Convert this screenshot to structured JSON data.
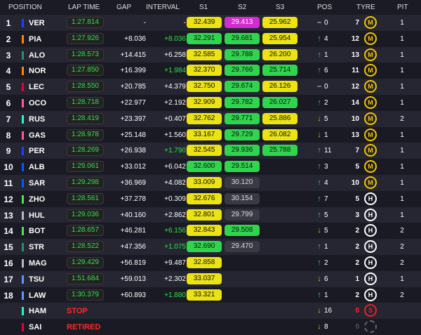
{
  "header": {
    "position": "POSITION",
    "lap_time": "LAP TIME",
    "gap": "GAP",
    "interval": "INTERVAL",
    "s1": "S1",
    "s2": "S2",
    "s3": "S3",
    "pos": "POS",
    "tyre": "TYRE",
    "pit": "PIT"
  },
  "colors": {
    "red_bull": "#1e41ff",
    "mclaren": "#ff8700",
    "aston": "#2a8f6a",
    "ferrari": "#e8002d",
    "alpine": "#ff5aa0",
    "mercedes": "#27f4d2",
    "williams": "#005aff",
    "haas": "#b6babd",
    "kick": "#52e252",
    "rb": "#6692ff"
  },
  "rows": [
    {
      "pos": "1",
      "driver": "VER",
      "team_color": "#1e41ff",
      "lap": "1:27.814",
      "gap": "-",
      "interval": "-",
      "interval_color": "#ffffff",
      "s1": "32.439",
      "s1c": "y",
      "s2": "29.413",
      "s2c": "p",
      "s3": "25.962",
      "s3c": "y",
      "arrow": "–",
      "arrow_dir": "eq",
      "chg": "0",
      "tyre_age": "7",
      "tyre": "M",
      "pit": "1"
    },
    {
      "pos": "2",
      "driver": "PIA",
      "team_color": "#ff8700",
      "lap": "1:27.926",
      "gap": "+8.036",
      "interval": "+8.036",
      "interval_color": "#2fe34a",
      "s1": "32.291",
      "s1c": "g",
      "s2": "29.681",
      "s2c": "g",
      "s3": "25.954",
      "s3c": "y",
      "arrow": "↑",
      "arrow_dir": "up",
      "chg": "4",
      "tyre_age": "12",
      "tyre": "M",
      "pit": "1"
    },
    {
      "pos": "3",
      "driver": "ALO",
      "team_color": "#2a8f6a",
      "lap": "1:28.573",
      "gap": "+14.415",
      "interval": "+6.258",
      "interval_color": "#ffffff",
      "s1": "32.585",
      "s1c": "y",
      "s2": "29.788",
      "s2c": "g",
      "s3": "26.200",
      "s3c": "y",
      "arrow": "↑",
      "arrow_dir": "up",
      "chg": "1",
      "tyre_age": "13",
      "tyre": "M",
      "pit": "1"
    },
    {
      "pos": "4",
      "driver": "NOR",
      "team_color": "#ff8700",
      "lap": "1:27.850",
      "gap": "+16.399",
      "interval": "+1.984",
      "interval_color": "#2fe34a",
      "s1": "32.370",
      "s1c": "y",
      "s2": "29.766",
      "s2c": "g",
      "s3": "25.714",
      "s3c": "g",
      "arrow": "↑",
      "arrow_dir": "up",
      "chg": "6",
      "tyre_age": "11",
      "tyre": "M",
      "pit": "1"
    },
    {
      "pos": "5",
      "driver": "LEC",
      "team_color": "#e8002d",
      "lap": "1:28.550",
      "gap": "+20.785",
      "interval": "+4.379",
      "interval_color": "#ffffff",
      "s1": "32.750",
      "s1c": "y",
      "s2": "29.674",
      "s2c": "g",
      "s3": "26.126",
      "s3c": "y",
      "arrow": "–",
      "arrow_dir": "eq",
      "chg": "0",
      "tyre_age": "12",
      "tyre": "M",
      "pit": "1"
    },
    {
      "pos": "6",
      "driver": "OCO",
      "team_color": "#ff5aa0",
      "lap": "1:28.718",
      "gap": "+22.977",
      "interval": "+2.192",
      "interval_color": "#ffffff",
      "s1": "32.909",
      "s1c": "y",
      "s2": "29.782",
      "s2c": "g",
      "s3": "26.027",
      "s3c": "g",
      "arrow": "↑",
      "arrow_dir": "up",
      "chg": "2",
      "tyre_age": "14",
      "tyre": "M",
      "pit": "1"
    },
    {
      "pos": "7",
      "driver": "RUS",
      "team_color": "#27f4d2",
      "lap": "1:28.419",
      "gap": "+23.397",
      "interval": "+0.407",
      "interval_color": "#ffffff",
      "s1": "32.762",
      "s1c": "y",
      "s2": "29.771",
      "s2c": "g",
      "s3": "25.886",
      "s3c": "y",
      "arrow": "↓",
      "arrow_dir": "dn",
      "chg": "5",
      "tyre_age": "10",
      "tyre": "M",
      "pit": "2"
    },
    {
      "pos": "8",
      "driver": "GAS",
      "team_color": "#ff5aa0",
      "lap": "1:28.978",
      "gap": "+25.148",
      "interval": "+1.560",
      "interval_color": "#ffffff",
      "s1": "33.167",
      "s1c": "y",
      "s2": "29.729",
      "s2c": "g",
      "s3": "26.082",
      "s3c": "y",
      "arrow": "↓",
      "arrow_dir": "dn",
      "chg": "1",
      "tyre_age": "13",
      "tyre": "M",
      "pit": "1"
    },
    {
      "pos": "9",
      "driver": "PER",
      "team_color": "#1e41ff",
      "lap": "1:28.269",
      "gap": "+26.938",
      "interval": "+1.790",
      "interval_color": "#2fe34a",
      "s1": "32.545",
      "s1c": "y",
      "s2": "29.936",
      "s2c": "g",
      "s3": "25.788",
      "s3c": "g",
      "arrow": "↑",
      "arrow_dir": "up",
      "chg": "11",
      "tyre_age": "7",
      "tyre": "M",
      "pit": "1"
    },
    {
      "pos": "10",
      "driver": "ALB",
      "team_color": "#005aff",
      "lap": "1:29.061",
      "gap": "+33.012",
      "interval": "+6.042",
      "interval_color": "#ffffff",
      "s1": "32.600",
      "s1c": "g",
      "s2": "29.514",
      "s2c": "g",
      "s3": "",
      "s3c": "",
      "arrow": "↑",
      "arrow_dir": "up",
      "chg": "3",
      "tyre_age": "5",
      "tyre": "M",
      "pit": "1"
    },
    {
      "pos": "11",
      "driver": "SAR",
      "team_color": "#005aff",
      "lap": "1:29.298",
      "gap": "+36.969",
      "interval": "+4.082",
      "interval_color": "#ffffff",
      "s1": "33.009",
      "s1c": "y",
      "s2": "30.120",
      "s2c": "n",
      "s3": "",
      "s3c": "",
      "arrow": "↑",
      "arrow_dir": "up",
      "chg": "4",
      "tyre_age": "10",
      "tyre": "M",
      "pit": "1"
    },
    {
      "pos": "12",
      "driver": "ZHO",
      "team_color": "#52e252",
      "lap": "1:28.561",
      "gap": "+37.278",
      "interval": "+0.309",
      "interval_color": "#ffffff",
      "s1": "32.676",
      "s1c": "y",
      "s2": "30.154",
      "s2c": "n",
      "s3": "",
      "s3c": "",
      "arrow": "↑",
      "arrow_dir": "up",
      "chg": "7",
      "tyre_age": "5",
      "tyre": "H",
      "pit": "1"
    },
    {
      "pos": "13",
      "driver": "HUL",
      "team_color": "#b6babd",
      "lap": "1:29.036",
      "gap": "+40.160",
      "interval": "+2.862",
      "interval_color": "#ffffff",
      "s1": "32.801",
      "s1c": "y",
      "s2": "29.799",
      "s2c": "n",
      "s3": "",
      "s3c": "",
      "arrow": "↑",
      "arrow_dir": "up",
      "chg": "5",
      "tyre_age": "3",
      "tyre": "H",
      "pit": "1"
    },
    {
      "pos": "14",
      "driver": "BOT",
      "team_color": "#52e252",
      "lap": "1:28.657",
      "gap": "+46.281",
      "interval": "+6.156",
      "interval_color": "#2fe34a",
      "s1": "32.843",
      "s1c": "y",
      "s2": "29.508",
      "s2c": "g",
      "s3": "",
      "s3c": "",
      "arrow": "↓",
      "arrow_dir": "dn",
      "chg": "5",
      "tyre_age": "2",
      "tyre": "H",
      "pit": "2"
    },
    {
      "pos": "15",
      "driver": "STR",
      "team_color": "#2a8f6a",
      "lap": "1:28.522",
      "gap": "+47.356",
      "interval": "+1.075",
      "interval_color": "#2fe34a",
      "s1": "32.690",
      "s1c": "g",
      "s2": "29.470",
      "s2c": "n",
      "s3": "",
      "s3c": "",
      "arrow": "↑",
      "arrow_dir": "up",
      "chg": "1",
      "tyre_age": "2",
      "tyre": "H",
      "pit": "2"
    },
    {
      "pos": "16",
      "driver": "MAG",
      "team_color": "#b6babd",
      "lap": "1:29.429",
      "gap": "+56.819",
      "interval": "+9.487",
      "interval_color": "#ffffff",
      "s1": "32.858",
      "s1c": "y",
      "s2": "",
      "s2c": "",
      "s3": "",
      "s3c": "",
      "arrow": "↑",
      "arrow_dir": "up",
      "chg": "2",
      "tyre_age": "2",
      "tyre": "H",
      "pit": "2"
    },
    {
      "pos": "17",
      "driver": "TSU",
      "team_color": "#6692ff",
      "lap": "1:51.684",
      "gap": "+59.013",
      "interval": "+2.302",
      "interval_color": "#ffffff",
      "s1": "33.037",
      "s1c": "y",
      "s2": "",
      "s2c": "",
      "s3": "",
      "s3c": "",
      "arrow": "↓",
      "arrow_dir": "dn",
      "chg": "6",
      "tyre_age": "1",
      "tyre": "H",
      "pit": "1"
    },
    {
      "pos": "18",
      "driver": "LAW",
      "team_color": "#6692ff",
      "lap": "1:30.379",
      "gap": "+60.893",
      "interval": "+1.880",
      "interval_color": "#2fe34a",
      "s1": "33.321",
      "s1c": "y",
      "s2": "",
      "s2c": "",
      "s3": "",
      "s3c": "",
      "arrow": "↑",
      "arrow_dir": "up",
      "chg": "1",
      "tyre_age": "2",
      "tyre": "H",
      "pit": "2"
    }
  ],
  "retired": [
    {
      "driver": "HAM",
      "team_color": "#27f4d2",
      "status": "STOP",
      "arrow": "↓",
      "arrow_dir": "dn",
      "chg": "16",
      "tyre_age": "0",
      "tyre_age_color": "#ff2a2a",
      "tyre": "S"
    },
    {
      "driver": "SAI",
      "team_color": "#e8002d",
      "status": "RETIRED",
      "arrow": "↓",
      "arrow_dir": "dn",
      "chg": "8",
      "tyre_age": "0",
      "tyre_age_color": "#555555",
      "tyre": ""
    }
  ]
}
